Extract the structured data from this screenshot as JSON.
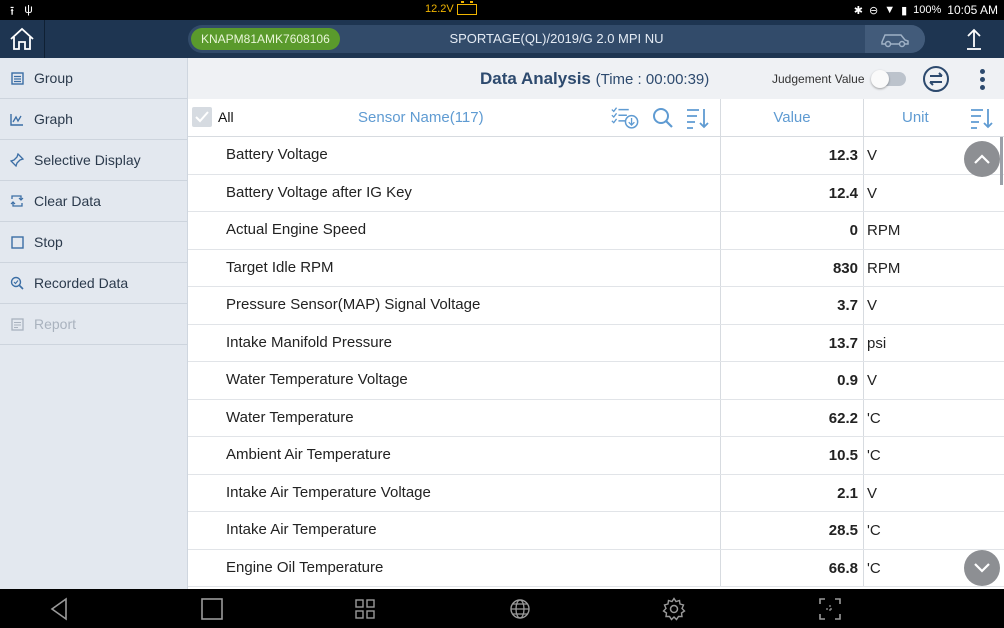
{
  "status_bar": {
    "voltage": "12.2V",
    "battery_percent": "100%",
    "time": "10:05 AM"
  },
  "header": {
    "vin": "KNAPM81AMK7608106",
    "vehicle": "SPORTAGE(QL)/2019/G 2.0 MPI NU"
  },
  "sidebar": {
    "items": [
      {
        "label": "Group",
        "icon": "group-icon",
        "enabled": true
      },
      {
        "label": "Graph",
        "icon": "graph-icon",
        "enabled": true
      },
      {
        "label": "Selective Display",
        "icon": "pin-icon",
        "enabled": true
      },
      {
        "label": "Clear Data",
        "icon": "refresh-icon",
        "enabled": true
      },
      {
        "label": "Stop",
        "icon": "stop-icon",
        "enabled": true
      },
      {
        "label": "Recorded Data",
        "icon": "search-record-icon",
        "enabled": true
      },
      {
        "label": "Report",
        "icon": "report-icon",
        "enabled": false
      }
    ]
  },
  "main": {
    "title": "Data Analysis",
    "time_label": "(Time : 00:00:39)",
    "judgement_label": "Judgement Value",
    "judgement_on": false,
    "columns": {
      "all": "All",
      "sensor": "Sensor Name(117)",
      "value": "Value",
      "unit": "Unit"
    },
    "rows": [
      {
        "name": "Battery Voltage",
        "value": "12.3",
        "unit": "V"
      },
      {
        "name": "Battery Voltage after IG Key",
        "value": "12.4",
        "unit": "V"
      },
      {
        "name": "Actual Engine Speed",
        "value": "0",
        "unit": "RPM"
      },
      {
        "name": "Target Idle RPM",
        "value": "830",
        "unit": "RPM"
      },
      {
        "name": "Pressure Sensor(MAP) Signal Voltage",
        "value": "3.7",
        "unit": "V"
      },
      {
        "name": "Intake Manifold Pressure",
        "value": "13.7",
        "unit": "psi"
      },
      {
        "name": "Water Temperature Voltage",
        "value": "0.9",
        "unit": "V"
      },
      {
        "name": "Water Temperature",
        "value": "62.2",
        "unit": "'C"
      },
      {
        "name": "Ambient Air Temperature",
        "value": "10.5",
        "unit": "'C"
      },
      {
        "name": "Intake Air Temperature Voltage",
        "value": "2.1",
        "unit": "V"
      },
      {
        "name": "Intake Air Temperature",
        "value": "28.5",
        "unit": "'C"
      },
      {
        "name": "Engine Oil Temperature",
        "value": "66.8",
        "unit": "'C"
      }
    ]
  },
  "colors": {
    "header_bg": "#1e3551",
    "vin_green": "#5a9a2c",
    "accent_blue": "#5f9bd2",
    "title_blue": "#2d4a6e",
    "sidebar_bg": "#e3e8ef"
  }
}
